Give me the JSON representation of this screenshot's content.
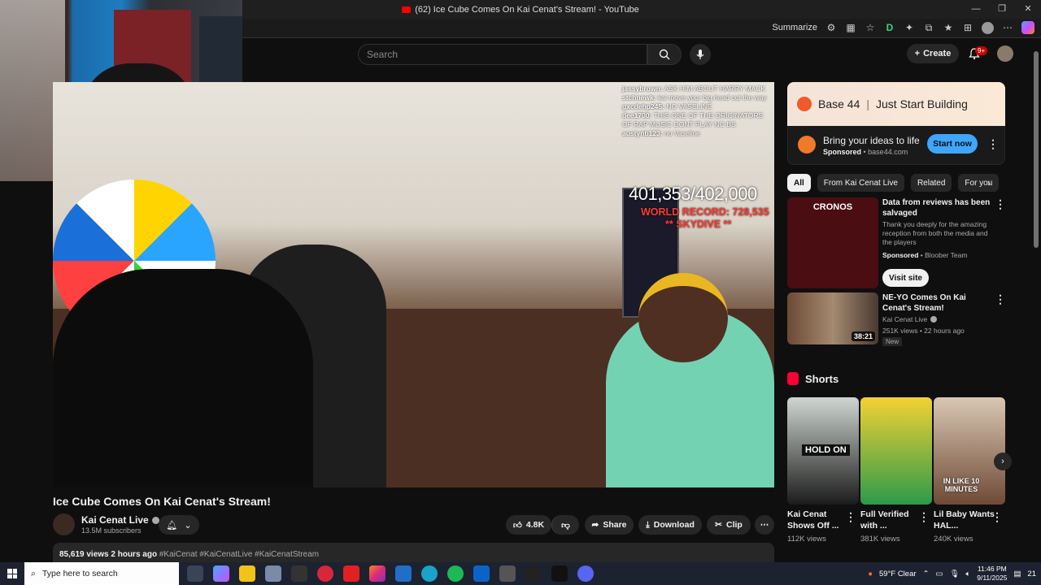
{
  "window": {
    "title": "(62) Ice Cube Comes On Kai Cenat's Stream! - YouTube",
    "controls": [
      "—",
      "❐",
      "✕"
    ]
  },
  "browser": {
    "summarize_label": "Summarize"
  },
  "header": {
    "search_placeholder": "Search",
    "create_label": "Create",
    "notif_count": "9+"
  },
  "stream_overlay": {
    "chat": [
      {
        "user": "jassybrown:",
        "msg": "ASK HIM ABOUT HARRY MACK"
      },
      {
        "user": "stchnewk:",
        "msg": "kai move your big head out the way"
      },
      {
        "user": "gxcdehp245:",
        "msg": "NO VASELINE"
      },
      {
        "user": "dee1700:",
        "msg": "THIS ONE OF THE ORIGINATORS OF RAP MUSIC DONT PLAY NO BS"
      },
      {
        "user": "austynb123:",
        "msg": "no Vaseline"
      }
    ],
    "counter": "401,353/402,000",
    "record": "WORLD RECORD: 728,535",
    "event": "** SKYDIVE **"
  },
  "video": {
    "title": "Ice Cube Comes On Kai Cenat's Stream!",
    "channel": "Kai Cenat Live",
    "subscribers": "13.5M subscribers",
    "likes": "4.8K",
    "share_label": "Share",
    "download_label": "Download",
    "clip_label": "Clip",
    "views": "85,619 views",
    "age": "2 hours ago",
    "tags": "#KaiCenat #KaiCenatLive #KaiCenatStream"
  },
  "ad": {
    "brand": "Base 44",
    "tagline": "Just Start Building",
    "title": "Bring your ideas to life",
    "sponsored": "Sponsored",
    "domain": "base44.com",
    "cta": "Start now"
  },
  "chips": [
    "All",
    "From Kai Cenat Live",
    "Related",
    "For you"
  ],
  "recommendations": [
    {
      "title": "Data from reviews has been salvaged",
      "desc": "Thank you deeply for the amazing reception from both the media and the players",
      "sponsored": "Sponsored",
      "advertiser": "Bloober Team",
      "cta": "Visit site",
      "thumb_text": "CRONOS"
    },
    {
      "title": "NE-YO Comes On Kai Cenat's Stream!",
      "channel": "Kai Cenat Live",
      "meta": "251K views • 22 hours ago",
      "badge": "New",
      "duration": "38:21"
    }
  ],
  "shorts": {
    "heading": "Shorts",
    "items": [
      {
        "title": "Kai Cenat Shows Off ...",
        "views": "112K views",
        "overlay": "HOLD ON"
      },
      {
        "title": "Full Verified with ...",
        "views": "381K views",
        "overlay": ""
      },
      {
        "title": "Lil Baby Wants HAL...",
        "views": "240K views",
        "overlay": "IN LIKE 10 MINUTES"
      }
    ]
  },
  "taskbar": {
    "search_placeholder": "Type here to search",
    "weather": "59°F  Clear",
    "time": "11:46 PM",
    "date": "9/11/2025",
    "notif": "21"
  }
}
